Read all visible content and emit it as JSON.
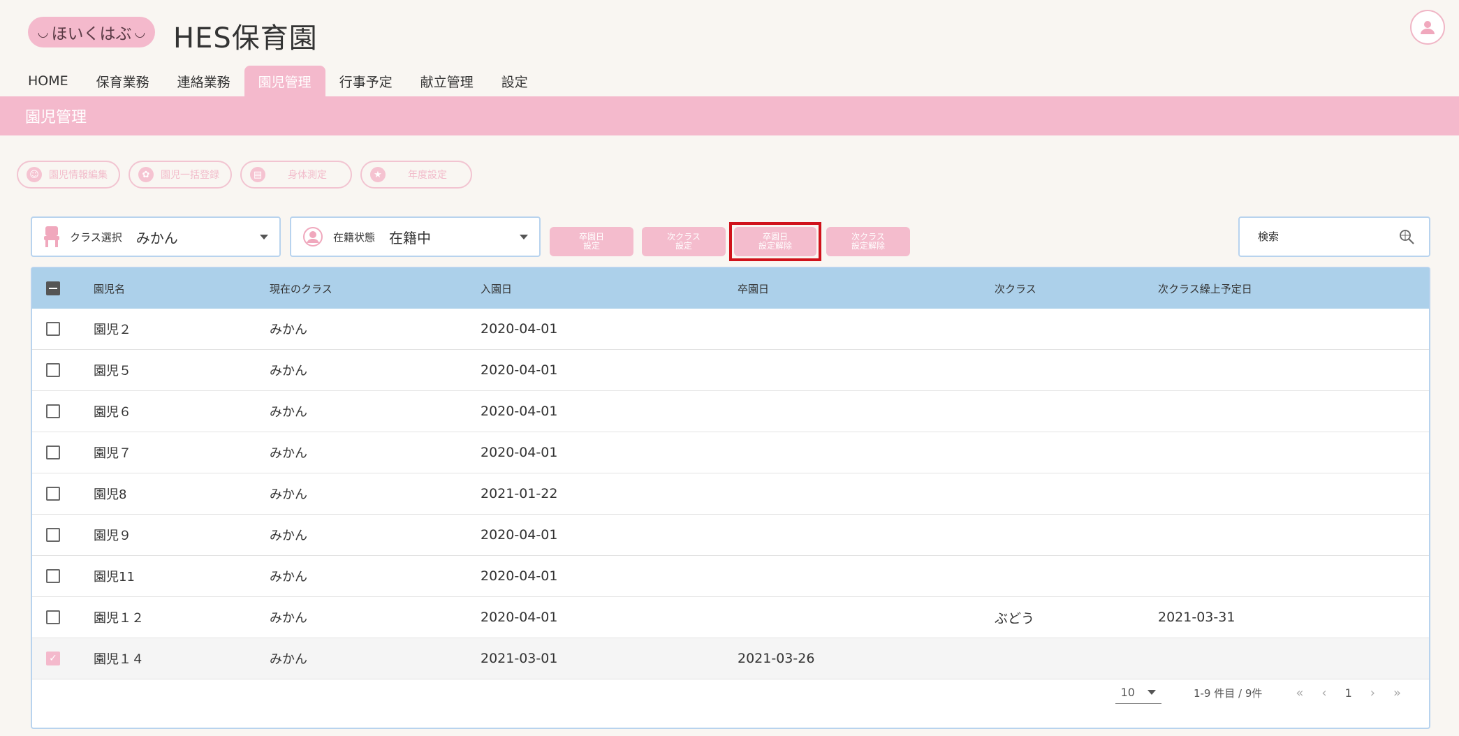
{
  "header": {
    "logo_text": "ほいくはぶ",
    "logo_face": "◡",
    "app_title": "HES保育園"
  },
  "nav": [
    {
      "label": "HOME"
    },
    {
      "label": "保育業務"
    },
    {
      "label": "連絡業務"
    },
    {
      "label": "園児管理"
    },
    {
      "label": "行事予定"
    },
    {
      "label": "献立管理"
    },
    {
      "label": "設定"
    }
  ],
  "page_title": "園児管理",
  "actions": [
    {
      "label": "園児情報編集",
      "icon": "person-icon"
    },
    {
      "label": "園児一括登録",
      "icon": "group-icon"
    },
    {
      "label": "身体測定",
      "icon": "ruler-icon"
    },
    {
      "label": "年度設定",
      "icon": "star-icon"
    }
  ],
  "filters": {
    "class_label": "クラス選択",
    "class_value": "みかん",
    "status_label": "在籍状態",
    "status_value": "在籍中"
  },
  "buttons": {
    "grad_date_set": "卒園日\n設定",
    "next_class_set": "次クラス\n設定",
    "grad_date_clear": "卒園日\n設定解除",
    "next_class_clear": "次クラス\n設定解除"
  },
  "search": {
    "placeholder": "検索"
  },
  "table": {
    "columns": [
      "園児名",
      "現在のクラス",
      "入園日",
      "卒園日",
      "次クラス",
      "次クラス繰上予定日"
    ],
    "rows": [
      {
        "name": "園児２",
        "class": "みかん",
        "entry": "2020-04-01",
        "grad": "",
        "next_class": "",
        "next_date": "",
        "checked": false
      },
      {
        "name": "園児５",
        "class": "みかん",
        "entry": "2020-04-01",
        "grad": "",
        "next_class": "",
        "next_date": "",
        "checked": false
      },
      {
        "name": "園児６",
        "class": "みかん",
        "entry": "2020-04-01",
        "grad": "",
        "next_class": "",
        "next_date": "",
        "checked": false
      },
      {
        "name": "園児７",
        "class": "みかん",
        "entry": "2020-04-01",
        "grad": "",
        "next_class": "",
        "next_date": "",
        "checked": false
      },
      {
        "name": "園児8",
        "class": "みかん",
        "entry": "2021-01-22",
        "grad": "",
        "next_class": "",
        "next_date": "",
        "checked": false
      },
      {
        "name": "園児９",
        "class": "みかん",
        "entry": "2020-04-01",
        "grad": "",
        "next_class": "",
        "next_date": "",
        "checked": false
      },
      {
        "name": "園児11",
        "class": "みかん",
        "entry": "2020-04-01",
        "grad": "",
        "next_class": "",
        "next_date": "",
        "checked": false
      },
      {
        "name": "園児１２",
        "class": "みかん",
        "entry": "2020-04-01",
        "grad": "",
        "next_class": "ぶどう",
        "next_date": "2021-03-31",
        "checked": false
      },
      {
        "name": "園児１４",
        "class": "みかん",
        "entry": "2021-03-01",
        "grad": "2021-03-26",
        "next_class": "",
        "next_date": "",
        "checked": true
      }
    ]
  },
  "pagination": {
    "per_page": "10",
    "range": "1-9 件目 / 9件",
    "current_page": "1",
    "first": "«",
    "prev": "‹",
    "next": "›",
    "last": "»"
  },
  "colors": {
    "brand_pink": "#f4b9cc",
    "header_blue": "#acd0ea",
    "border_blue": "#b8d3ee",
    "highlight_red": "#d0121b"
  }
}
